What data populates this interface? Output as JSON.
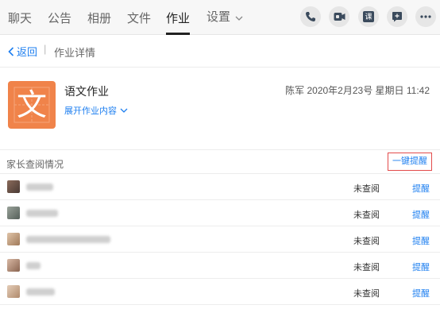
{
  "tabs": [
    {
      "label": "聊天"
    },
    {
      "label": "公告"
    },
    {
      "label": "相册"
    },
    {
      "label": "文件"
    },
    {
      "label": "作业"
    },
    {
      "label": "设置"
    }
  ],
  "toolbar": {
    "icons": [
      "phone-icon",
      "video-icon",
      "lesson-icon",
      "add-message-icon",
      "more-icon"
    ],
    "lesson_label": "课"
  },
  "subheader": {
    "back_label": "返回",
    "separator": "|",
    "crumb": "作业详情"
  },
  "homework": {
    "icon_char": "文",
    "title": "语文作业",
    "meta": "陈军 2020年2月23号 星期日 11:42",
    "expand_label": "展开作业内容",
    "icon_color": "#f0834a"
  },
  "section": {
    "title": "家长查阅情况",
    "remind_all_label": "一键提醒"
  },
  "parents": [
    {
      "status": "未查阅",
      "action": "提醒"
    },
    {
      "status": "未查阅",
      "action": "提醒"
    },
    {
      "status": "未查阅",
      "action": "提醒"
    },
    {
      "status": "未查阅",
      "action": "提醒"
    },
    {
      "status": "未查阅",
      "action": "提醒"
    }
  ],
  "colors": {
    "accent": "#1e7ff0",
    "highlight_border": "#e34b4b"
  }
}
